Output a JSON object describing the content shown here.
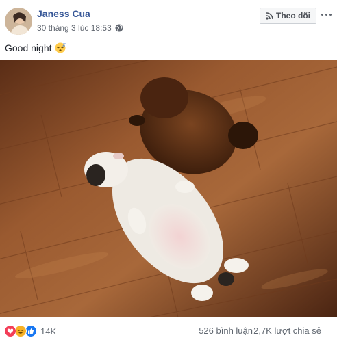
{
  "post": {
    "author": "Janess Cua",
    "timestamp": "30 tháng 3 lúc 18:53",
    "privacy_icon": "globe-icon",
    "follow_label": "Theo dõi",
    "text": "Good night",
    "text_emoji": "sleepy-face-emoji"
  },
  "footer": {
    "reaction_icons": [
      "love-icon",
      "haha-icon",
      "like-icon"
    ],
    "reaction_count": "14K",
    "comments": "526 bình luận",
    "shares": "2,7K lượt chia sẻ"
  },
  "colors": {
    "author_link": "#385898",
    "meta_text": "#616770",
    "like_blue": "#1877f2",
    "love_red": "#f33e58",
    "haha_yellow": "#f7b125"
  }
}
